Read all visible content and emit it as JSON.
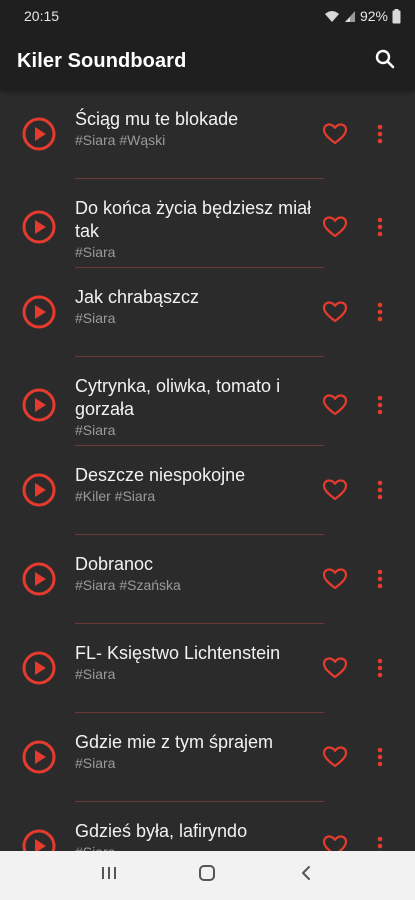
{
  "status": {
    "time": "20:15",
    "battery": "92%"
  },
  "app": {
    "title": "Kiler Soundboard"
  },
  "icons": {
    "search": "search-icon",
    "play": "play-circle-icon",
    "favorite": "heart-outline-icon",
    "more": "more-vert-icon"
  },
  "colors": {
    "accent": "#e53b2f",
    "background": "#2b2b2b",
    "appbar": "#1f1f1f",
    "subtitle": "#9a9a9a"
  },
  "sounds": [
    {
      "title": "Ściąg mu te blokade",
      "tags": "#Siara #Wąski"
    },
    {
      "title": "Do końca życia będziesz miał tak",
      "tags": "#Siara"
    },
    {
      "title": "Jak chrabąszcz",
      "tags": "#Siara"
    },
    {
      "title": "Cytrynka, oliwka, tomato i gorzała",
      "tags": "#Siara"
    },
    {
      "title": "Deszcze niespokojne",
      "tags": "#Kiler #Siara"
    },
    {
      "title": "Dobranoc",
      "tags": "#Siara #Szańska"
    },
    {
      "title": "FL- Księstwo Lichtenstein",
      "tags": "#Siara"
    },
    {
      "title": "Gdzie mie z tym śprajem",
      "tags": "#Siara"
    },
    {
      "title": "Gdzieś była, lafiryndo",
      "tags": "#Siara"
    }
  ]
}
